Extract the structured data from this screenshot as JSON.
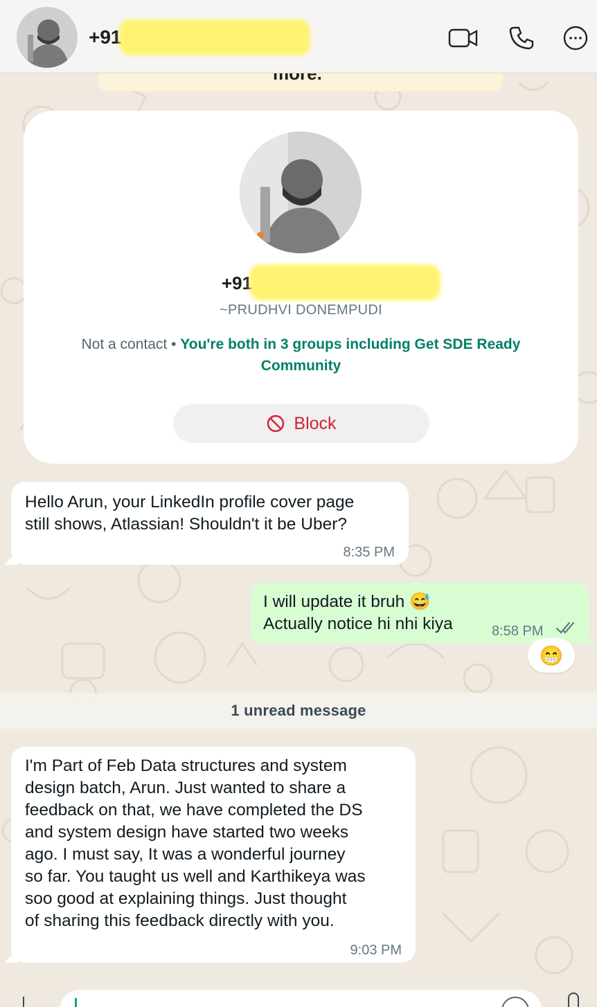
{
  "header": {
    "phone_prefix": "+91",
    "icons": [
      "video-call-icon",
      "voice-call-icon",
      "more-options-icon"
    ]
  },
  "banner": {
    "partial_text": "more."
  },
  "profile": {
    "phone_prefix": "+91",
    "name": "~PRUDHVI DONEMPUDI",
    "not_contact": "Not a contact",
    "separator": " • ",
    "groups_text": "You're both in 3 groups including Get SDE Ready Community",
    "block_label": "Block"
  },
  "messages": [
    {
      "direction": "incoming",
      "lines": [
        "Hello Arun, your LinkedIn profile cover page",
        "still shows, Atlassian! Shouldn't it be Uber?"
      ],
      "time": "8:35 PM"
    },
    {
      "direction": "outgoing",
      "lines": [
        "I will update it bruh 😅",
        "Actually notice hi nhi kiya"
      ],
      "time": "8:58 PM",
      "status": "read",
      "reaction": "😁"
    },
    {
      "direction": "incoming",
      "lines": [
        "I'm Part of Feb Data structures and system",
        "design batch, Arun. Just wanted to share a",
        "feedback on that, we have completed the DS",
        "and system design have started two weeks",
        "ago. I must say, It was a wonderful journey",
        "so far. You taught us well and Karthikeya was",
        "soo good at explaining things.  Just thought",
        "of sharing this feedback directly with you."
      ],
      "time": "9:03 PM"
    }
  ],
  "unread_divider": "1 unread message",
  "colors": {
    "accent_green": "#008069",
    "outgoing_bubble": "#d9fdd3",
    "block_red": "#d21f3c",
    "read_tick": "#667781"
  }
}
